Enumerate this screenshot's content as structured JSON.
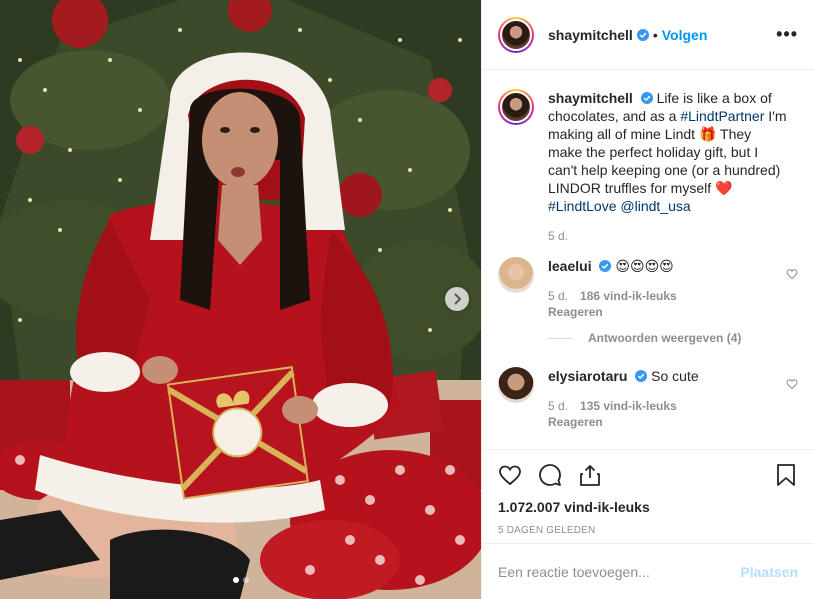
{
  "post": {
    "author": "shaymitchell",
    "follow_label": "Volgen",
    "bullet": "•",
    "more_label": "•••",
    "carousel": {
      "slides": 2,
      "active": 1
    }
  },
  "caption": {
    "username": "shaymitchell",
    "text_1": "Life is like a box of chocolates, and as a ",
    "hashtag_1": "#LindtPartner",
    "text_2": " I'm making all of mine Lindt 🎁 They make the perfect holiday gift, but I can't help keeping one (or a hundred) LINDOR truffles for myself ❤️ ",
    "hashtag_2": "#LindtLove",
    "mention": "@lindt_usa",
    "time": "5 d."
  },
  "comments": [
    {
      "username": "leaelui",
      "text": "😍😍😍😍",
      "time": "5 d.",
      "likes": "186 vind-ik-leuks",
      "reply_label": "Reageren",
      "view_replies": "Antwoorden weergeven (4)"
    },
    {
      "username": "elysiarotaru",
      "text": "So cute",
      "time": "5 d.",
      "likes": "135 vind-ik-leuks",
      "reply_label": "Reageren"
    }
  ],
  "footer": {
    "likes": "1.072.007 vind-ik-leuks",
    "date": "5 DAGEN GELEDEN",
    "comment_placeholder": "Een reactie toevoegen...",
    "post_label": "Plaatsen"
  },
  "icons": {
    "verified": "verified-badge-icon",
    "like": "heart-icon",
    "comment": "comment-icon",
    "share": "share-icon",
    "save": "bookmark-icon",
    "next": "chevron-right-icon"
  },
  "colors": {
    "link": "#0095f6",
    "hashtag": "#00376b",
    "muted": "#8e8e8e",
    "dress": "#b5121b"
  }
}
